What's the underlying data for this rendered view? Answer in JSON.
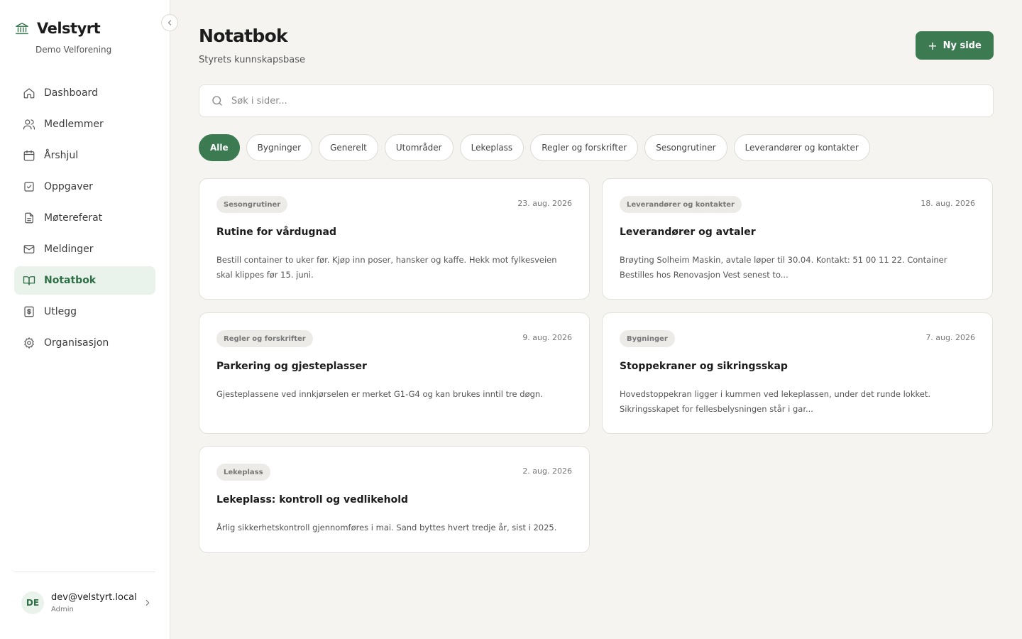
{
  "brand": {
    "name": "Velstyrt",
    "org": "Demo Velforening",
    "icon": "bank-icon"
  },
  "nav": {
    "items": [
      {
        "label": "Dashboard",
        "icon": "home-icon"
      },
      {
        "label": "Medlemmer",
        "icon": "users-icon"
      },
      {
        "label": "Årshjul",
        "icon": "calendar-icon"
      },
      {
        "label": "Oppgaver",
        "icon": "checkbox-icon"
      },
      {
        "label": "Møtereferat",
        "icon": "document-icon"
      },
      {
        "label": "Meldinger",
        "icon": "mail-icon"
      },
      {
        "label": "Notatbok",
        "icon": "book-icon",
        "active": true
      },
      {
        "label": "Utlegg",
        "icon": "receipt-dollar-icon"
      },
      {
        "label": "Organisasjon",
        "icon": "gear-icon"
      }
    ]
  },
  "user": {
    "initials": "DE",
    "email": "dev@velstyrt.local",
    "role": "Admin"
  },
  "header": {
    "title": "Notatbok",
    "subtitle": "Styrets kunnskapsbase",
    "new_button": "Ny side"
  },
  "search": {
    "placeholder": "Søk i sider...",
    "value": ""
  },
  "filters": [
    "Alle",
    "Bygninger",
    "Generelt",
    "Utområder",
    "Lekeplass",
    "Regler og forskrifter",
    "Sesongrutiner",
    "Leverandører og kontakter"
  ],
  "active_filter": "Alle",
  "cards": [
    {
      "tag": "Sesongrutiner",
      "date": "23. aug. 2026",
      "title": "Rutine for vårdugnad",
      "excerpt": "Bestill container to uker før. Kjøp inn poser, hansker og kaffe. Hekk mot fylkesveien skal klippes før 15. juni."
    },
    {
      "tag": "Leverandører og kontakter",
      "date": "18. aug. 2026",
      "title": "Leverandører og avtaler",
      "excerpt": "Brøyting Solheim Maskin, avtale løper til 30.04. Kontakt: 51 00 11 22. Container Bestilles hos Renovasjon Vest senest to..."
    },
    {
      "tag": "Regler og forskrifter",
      "date": "9. aug. 2026",
      "title": "Parkering og gjesteplasser",
      "excerpt": "Gjesteplassene ved innkjørselen er merket G1-G4 og kan brukes inntil tre døgn."
    },
    {
      "tag": "Bygninger",
      "date": "7. aug. 2026",
      "title": "Stoppekraner og sikringsskap",
      "excerpt": "Hovedstoppekran ligger i kummen ved lekeplassen, under det runde lokket. Sikringsskapet for fellesbelysningen står i gar..."
    },
    {
      "tag": "Lekeplass",
      "date": "2. aug. 2026",
      "title": "Lekeplass: kontroll og vedlikehold",
      "excerpt": "Årlig sikkerhetskontroll gjennomføres i mai. Sand byttes hvert tredje år, sist i 2025."
    }
  ],
  "colors": {
    "accent": "#3c7a52",
    "active_bg": "#e9f3ec",
    "background": "#f5f4f1"
  }
}
